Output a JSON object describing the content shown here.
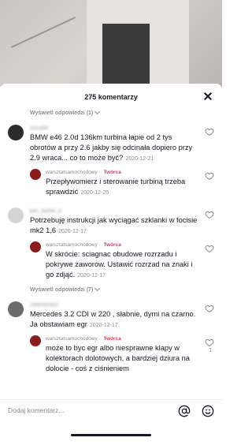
{
  "header": {
    "title": "275 komentarzy"
  },
  "comments": [
    {
      "type": "more",
      "label": "Wyświetl odpowiedzi (1)"
    },
    {
      "type": "comment",
      "username": "mosq94",
      "avatar_color": "#2c2c2c",
      "text": "BMW e46 2.0d 136km turbina łapie od 2 tys obrotów a przy 2.6 jakby się odcinała dopiero przy 2.9 wraca... co to może być?",
      "date": "2020-12-21"
    },
    {
      "type": "reply",
      "username": "warsztatsamochodowy",
      "badge": "Twórca",
      "avatar_color": "#8b1a1a",
      "text": "Przepływomierz i sterowanie turbiną trzeba sprawdzić",
      "date": "2020-12-25"
    },
    {
      "type": "comment",
      "username": "pan_bartek_b",
      "avatar_color": "#d5d5d7",
      "text": "Potrzebuję instrukcji jak wyciągać szklanki w focisie mk2 1,6",
      "date": "2020-12-17"
    },
    {
      "type": "reply",
      "username": "warsztatsamochodowy",
      "badge": "Twórca",
      "avatar_color": "#8b1a1a",
      "text": "W skrócie: sciagnac obudowe rozrzadu i pokrywe zaworow. Ustawić rozrzad na znaki i go zdjąć.",
      "date": "2020-12-17"
    },
    {
      "type": "more",
      "label": "Wyświetl odpowiedzi (7)"
    },
    {
      "type": "comment",
      "username": "robertstroisz",
      "avatar_color": "#6b6b6b",
      "text": "Mercedes 3.2 CDI w 220 , słabnie, dymi na czarno. Ja obstawiam egr",
      "date": "2020-12-17"
    },
    {
      "type": "reply",
      "username": "warsztatsamochodowy",
      "badge": "Twórca",
      "avatar_color": "#8b1a1a",
      "text": "może to byc egr albo niesprawne klapy w kolektorach dolotowych, a bardziej dziura na dolocie - coś z ciśnieniem",
      "date": "",
      "likes": "1"
    }
  ],
  "footer": {
    "placeholder": "Dodaj komentarz..."
  },
  "icons": {
    "close": "close-icon",
    "heart": "heart-icon",
    "at": "at-sign-icon",
    "emoji": "emoji-icon"
  }
}
